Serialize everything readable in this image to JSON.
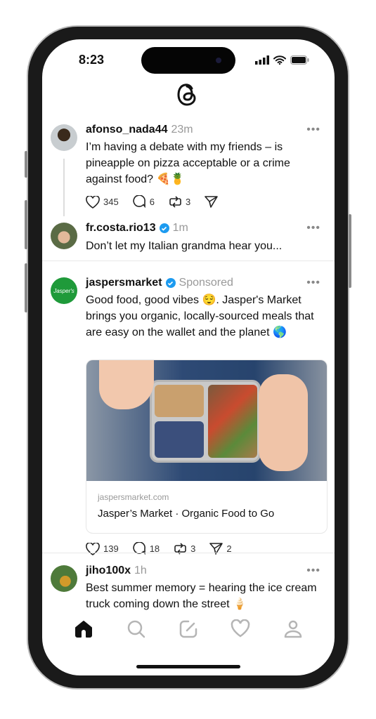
{
  "status_bar": {
    "time": "8:23",
    "icons": [
      "signal-icon",
      "wifi-icon",
      "battery-icon"
    ]
  },
  "header": {
    "logo": "threads-logo-icon"
  },
  "posts": [
    {
      "username": "afonso_nada44",
      "time": "23m",
      "verified": false,
      "text": "I’m having a debate with my friends – is pineapple on pizza acceptable or a crime against food? 🍕🍍",
      "likes": "345",
      "replies": "6",
      "reposts": "3",
      "shares": ""
    },
    {
      "username": "fr.costa.rio13",
      "time": "1m",
      "verified": true,
      "text": "Don’t let my Italian grandma hear you..."
    },
    {
      "username": "jaspersmarket",
      "time": "Sponsored",
      "verified": true,
      "text": "Good food, good vibes 😌. Jasper's Market brings you organic, locally-sourced meals that are easy on the wallet and the planet 🌎",
      "link_domain": "jaspersmarket.com",
      "link_title": "Jasper’s Market · Organic Food to Go",
      "likes": "139",
      "replies": "18",
      "reposts": "3",
      "shares": "2",
      "avatar_label": "Jasper's"
    },
    {
      "username": "jiho100x",
      "time": "1h",
      "verified": false,
      "text": "Best summer memory = hearing the ice cream truck coming down the street 🍦"
    }
  ],
  "more_label": "•••",
  "nav": [
    "home-icon",
    "search-icon",
    "compose-icon",
    "heart-icon",
    "profile-icon"
  ]
}
